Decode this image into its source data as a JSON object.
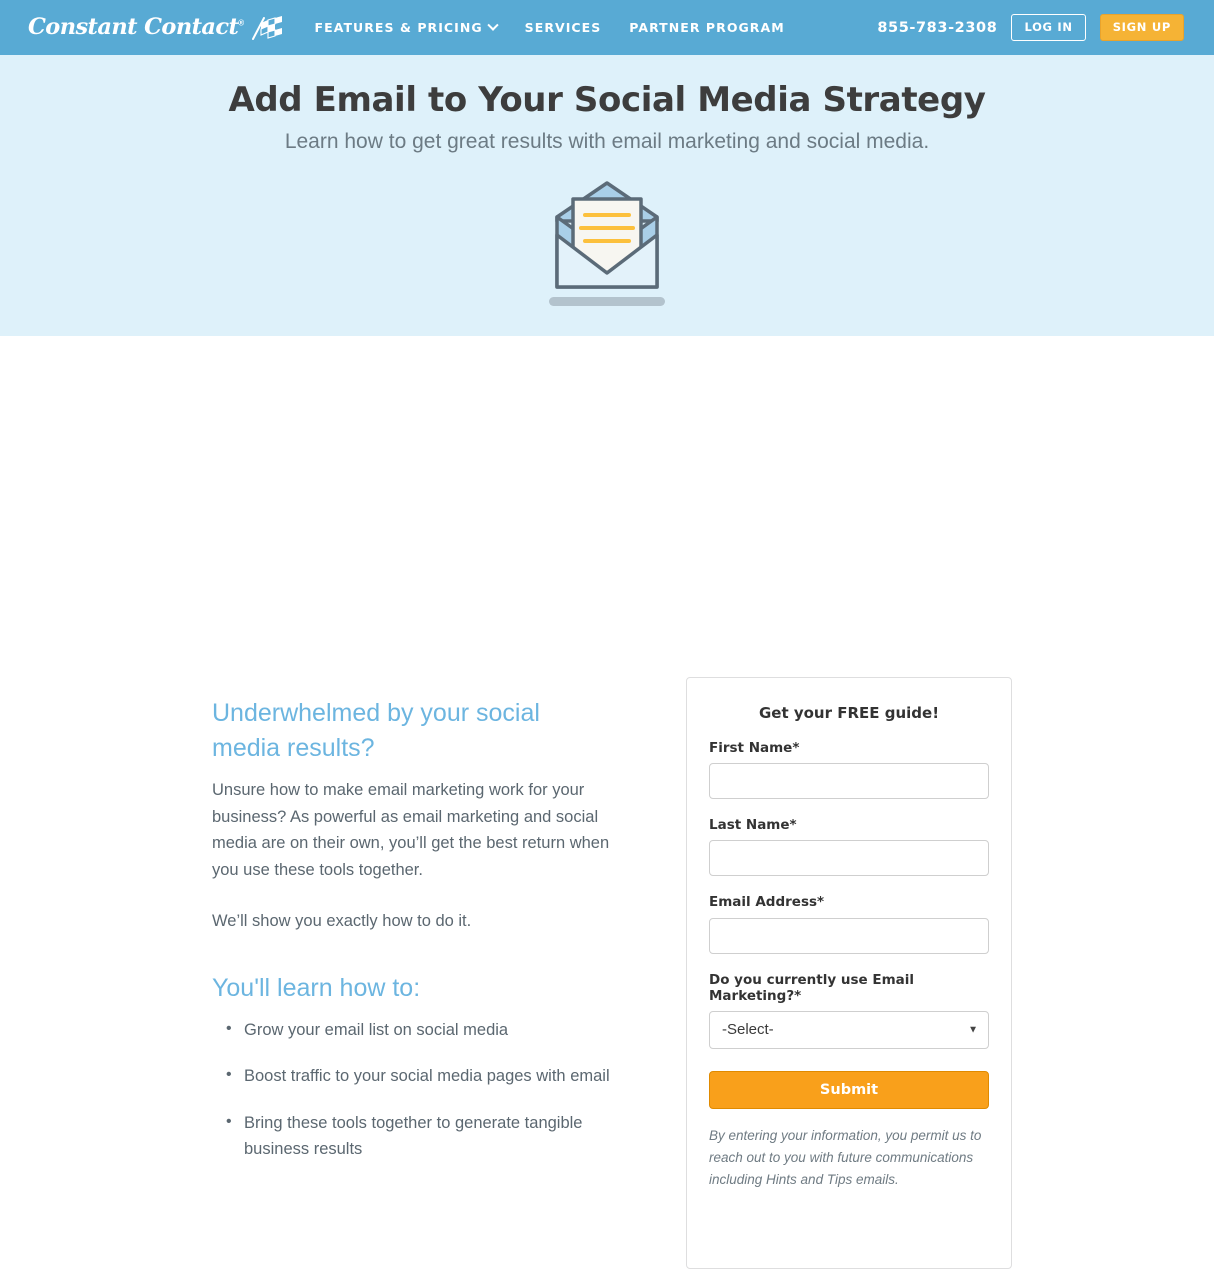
{
  "header": {
    "brand": {
      "name": "Constant Contact",
      "reg": "®",
      "flag_icon": "checkered-flag-icon"
    },
    "nav": [
      {
        "label": "FEATURES & PRICING",
        "has_caret": true,
        "icon": "chevron-down-icon"
      },
      {
        "label": "SERVICES",
        "has_caret": false
      },
      {
        "label": "PARTNER PROGRAM",
        "has_caret": false
      }
    ],
    "phone": "855-783-2308",
    "login_label": "LOG IN",
    "signup_label": "SIGN UP",
    "bg_color": "#58aad4",
    "signup_color": "#f5b335"
  },
  "hero": {
    "title": "Add Email to Your Social Media Strategy",
    "subtitle": "Learn how to get great results with email marketing and social media.",
    "art_icon": "open-envelope-with-letter-icon",
    "bg_color": "#def1fa"
  },
  "content": {
    "heading_1": "Underwhelmed by your social media results?",
    "paragraph_1": "Unsure how to make email marketing work for your business? As powerful as email marketing and social media are on their own, you’ll get the best return when you use these tools together.",
    "paragraph_2": "We’ll show you exactly how to do it.",
    "heading_2": "You'll learn how to:",
    "bullets": [
      "Grow your email list on social media",
      "Boost traffic to your social media pages with email",
      "Bring these tools together to generate tangible business results"
    ],
    "heading_color": "#6cb5e0"
  },
  "form": {
    "title": "Get your FREE guide!",
    "fields": [
      {
        "label": "First Name",
        "required": "*",
        "value": "",
        "placeholder": ""
      },
      {
        "label": "Last Name",
        "required": "*",
        "value": "",
        "placeholder": ""
      },
      {
        "label": "Email Address",
        "required": "*",
        "value": "",
        "placeholder": ""
      }
    ],
    "select": {
      "label": "Do you currently use Email Marketing?",
      "required": "*",
      "value": "-Select-",
      "caret_icon": "chevron-down-icon"
    },
    "submit_label": "Submit",
    "submit_color": "#f9a01b",
    "legal": "By entering your information, you permit us to reach out to you with future communications including Hints and Tips emails."
  }
}
